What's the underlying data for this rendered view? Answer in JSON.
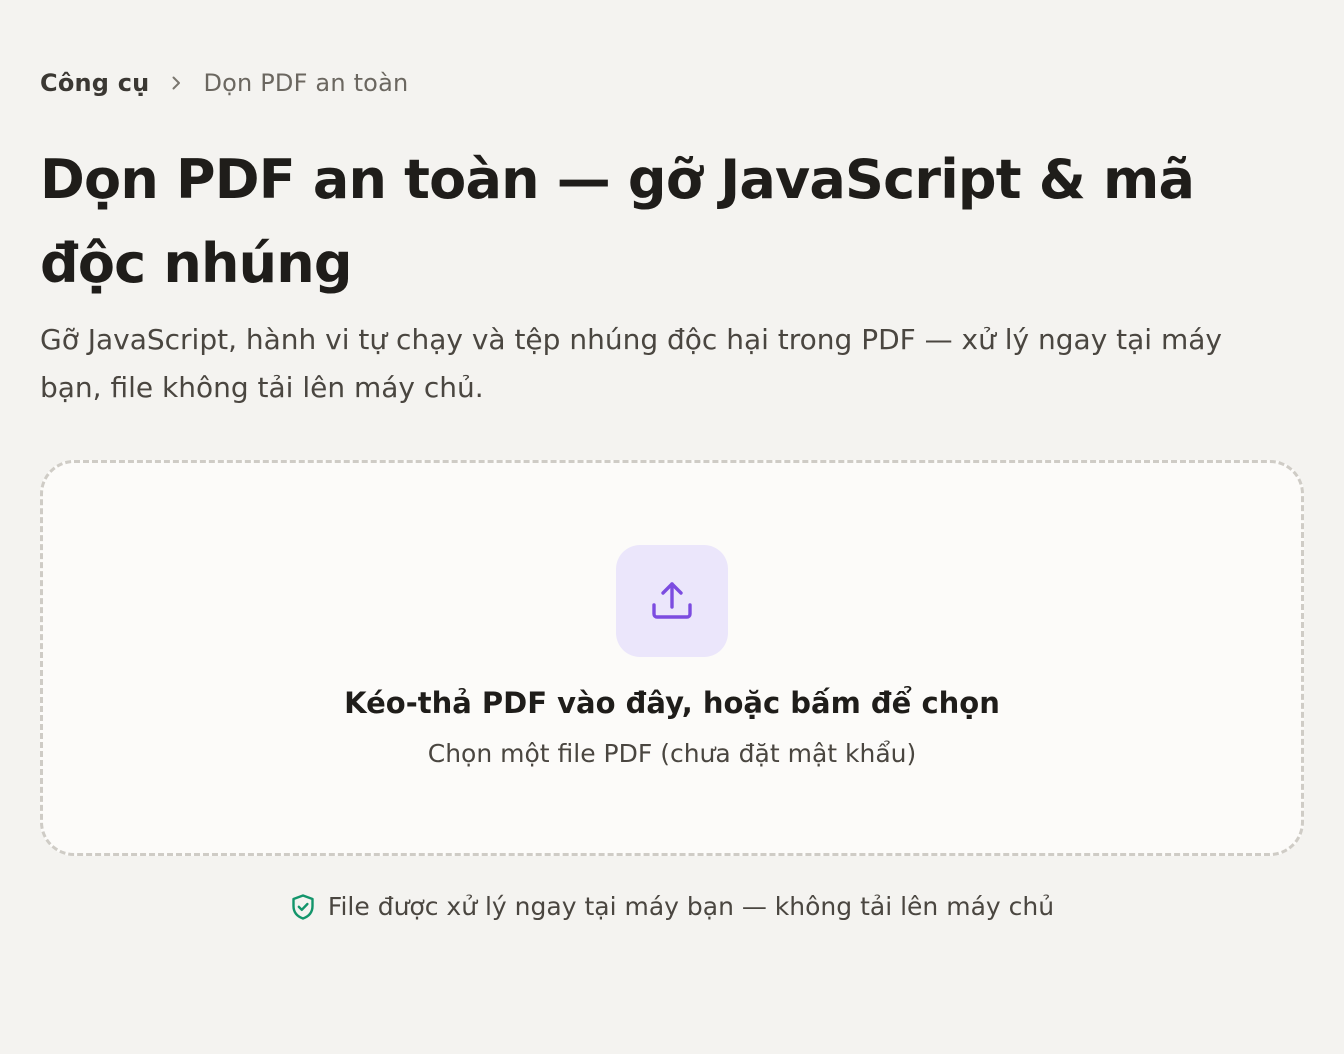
{
  "breadcrumb": {
    "parent": "Công cụ",
    "current": "Dọn PDF an toàn"
  },
  "page": {
    "title": "Dọn PDF an toàn — gỡ JavaScript & mã độc nhúng",
    "description": "Gỡ JavaScript, hành vi tự chạy và tệp nhúng độc hại trong PDF — xử lý ngay tại máy bạn, file không tải lên máy chủ."
  },
  "dropzone": {
    "title": "Kéo-thả PDF vào đây, hoặc bấm để chọn",
    "subtitle": "Chọn một file PDF (chưa đặt mật khẩu)"
  },
  "privacy": {
    "text": "File được xử lý ngay tại máy bạn — không tải lên máy chủ"
  },
  "icons": {
    "breadcrumb_separator": "chevron-right-icon",
    "upload": "upload-icon",
    "privacy": "shield-check-icon"
  },
  "colors": {
    "background": "#f4f3f0",
    "accent": "#7c4ce0",
    "accent_tint": "#ebe6fb",
    "safe_green": "#13956b"
  }
}
